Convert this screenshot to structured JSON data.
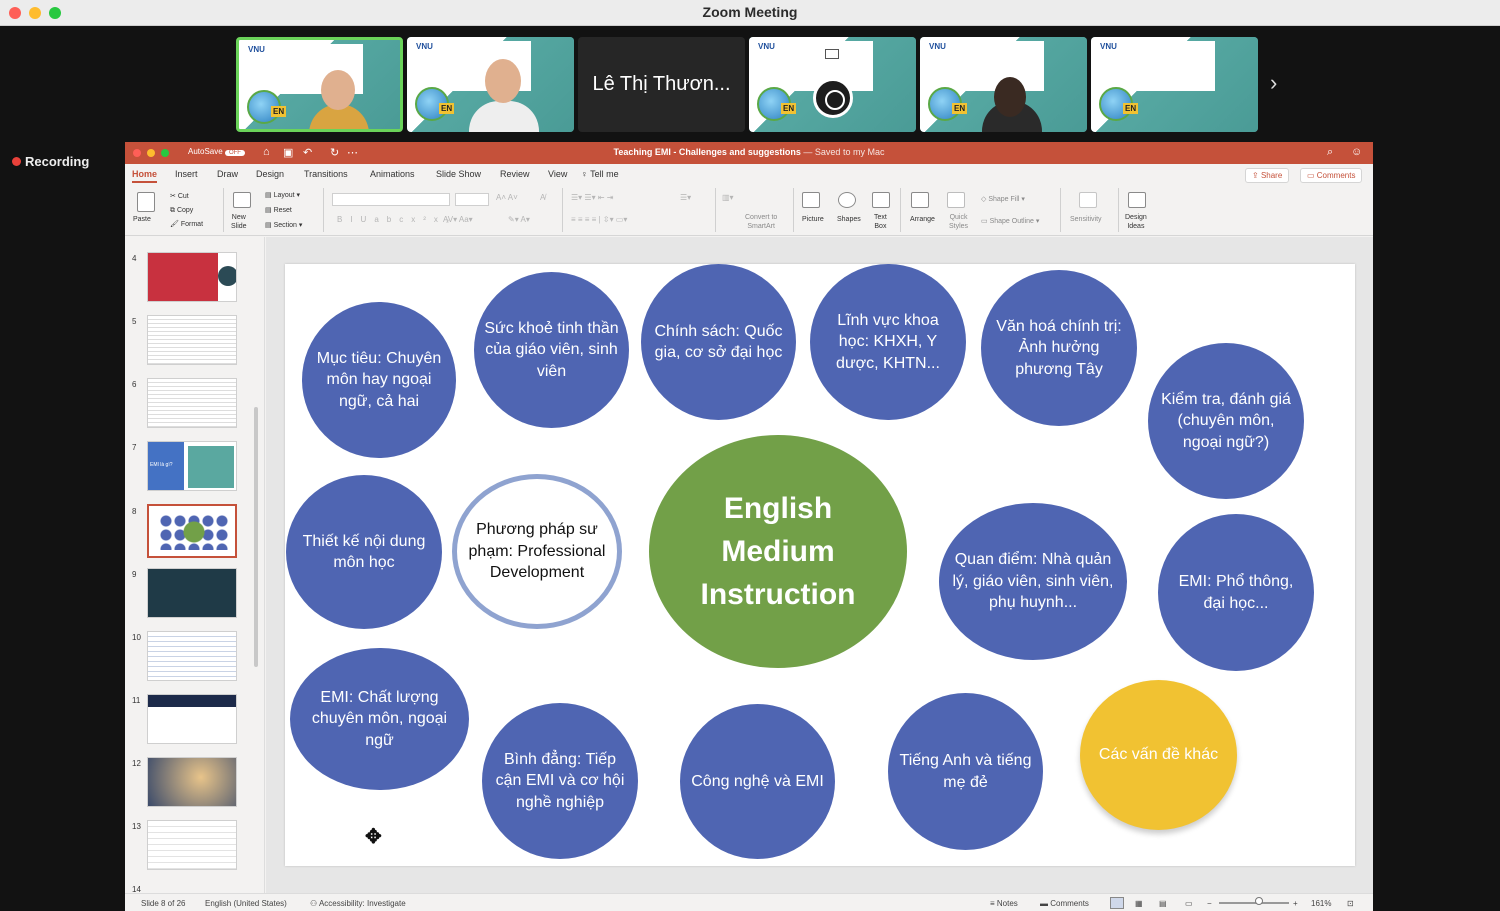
{
  "zoom": {
    "window_title": "Zoom Meeting",
    "participant_name_tile": "Lê Thị Thươn...",
    "vnu_logo": "VNU",
    "en_badge": "EN",
    "next_arrow": "›",
    "recording_label": "Recording"
  },
  "ppt": {
    "autosave_label": "AutoSave",
    "autosave_state": "OFF",
    "doc_title": "Teaching EMI - Challenges and suggestions",
    "saved_status": "— Saved to my Mac",
    "menu": [
      "Home",
      "Insert",
      "Draw",
      "Design",
      "Transitions",
      "Animations",
      "Slide Show",
      "Review",
      "View",
      "Tell me"
    ],
    "share_label": "Share",
    "comments_label": "Comments",
    "ribbon": {
      "paste": "Paste",
      "cut": "Cut",
      "copy": "Copy",
      "format": "Format",
      "new_slide": "New\nSlide",
      "layout": "Layout",
      "reset": "Reset",
      "section": "Section",
      "convert_smartart": "Convert to\nSmartArt",
      "picture": "Picture",
      "shapes": "Shapes",
      "text_box": "Text\nBox",
      "arrange": "Arrange",
      "quick_styles": "Quick\nStyles",
      "shape_fill": "Shape Fill",
      "shape_outline": "Shape Outline",
      "sensitivity": "Sensitivity",
      "design_ideas": "Design\nIdeas"
    },
    "slide_numbers": [
      "4",
      "5",
      "6",
      "7",
      "8",
      "9",
      "10",
      "11",
      "12",
      "13",
      "14"
    ],
    "thumb7_text": "EMI là gì?",
    "slide": {
      "center": "English Medium Instruction",
      "bubbles": [
        "Mục tiêu: Chuyên môn hay ngoại ngữ, cả hai",
        "Sức khoẻ tinh thần của giáo viên, sinh viên",
        "Chính sách: Quốc gia, cơ sở đại học",
        "Lĩnh vực khoa học: KHXH, Y dược, KHTN...",
        "Văn hoá chính trị: Ảnh hưởng phương Tây",
        "Kiểm tra, đánh giá (chuyên môn, ngoại ngữ?)",
        "Thiết kế nội dung môn học",
        "Phương pháp sư phạm: Professional Development",
        "Quan điểm: Nhà quản lý, giáo viên, sinh viên, phụ huynh...",
        "EMI: Phổ thông, đại học...",
        "EMI: Chất lượng chuyên môn, ngoại ngữ",
        "Bình đẳng: Tiếp cận EMI và cơ hội nghề nghiệp",
        "Công nghệ và EMI",
        "Tiếng Anh và tiếng mẹ đẻ",
        "Các vấn đề khác"
      ]
    },
    "status": {
      "slide_of": "Slide 8 of 26",
      "language": "English (United States)",
      "accessibility": "Accessibility: Investigate",
      "notes": "Notes",
      "comments": "Comments",
      "zoom": "161%"
    },
    "colors": {
      "accent": "#c5513a",
      "bubble_blue": "#4f65b2",
      "center_green": "#72a048",
      "gold": "#f1c232"
    }
  }
}
